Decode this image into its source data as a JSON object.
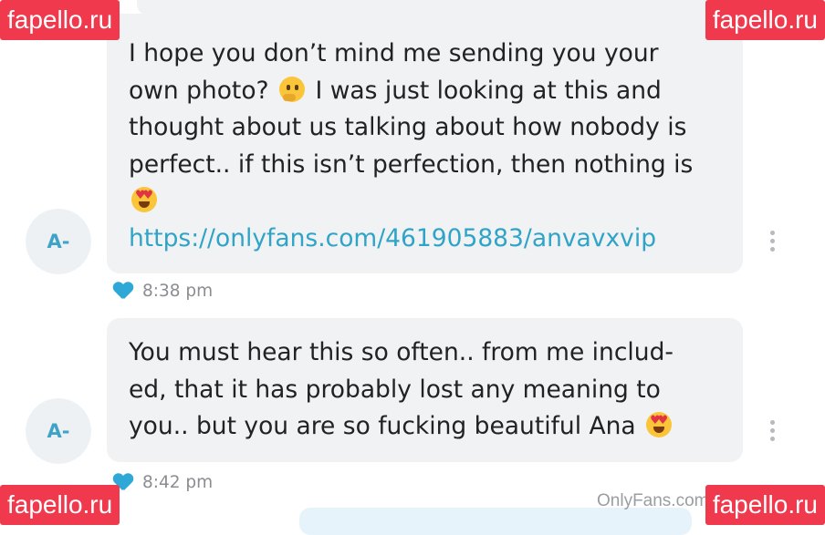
{
  "watermark": "fapello.ru",
  "credit": "OnlyFans.com/fapello",
  "messages": [
    {
      "avatar": "A-",
      "text_lines": [
        "I hope you don’t mind me sending you your",
        "own photo?",
        "I was just looking at this and",
        "thought about us talking about how nobody is",
        "perfect.. if this isn’t perfection, then nothing is"
      ],
      "link": "https://onlyfans.com/461905883/anvavxvip",
      "time": "8:38 pm",
      "emojis": [
        "thinking-face",
        "heart-eyes"
      ]
    },
    {
      "avatar": "A-",
      "text_lines": [
        "You must hear this so often.. from me includ-",
        "ed, that it has probably lost any meaning to",
        "you.. but you are so fucking beautiful Ana"
      ],
      "time": "8:42 pm",
      "emojis": [
        "heart-eyes"
      ]
    }
  ],
  "colors": {
    "bubble": "#f1f2f3",
    "link": "#2fa4c8",
    "avatar_text": "#3ea3c6",
    "heart": "#2fa8d8",
    "watermark": "#f0394d"
  }
}
